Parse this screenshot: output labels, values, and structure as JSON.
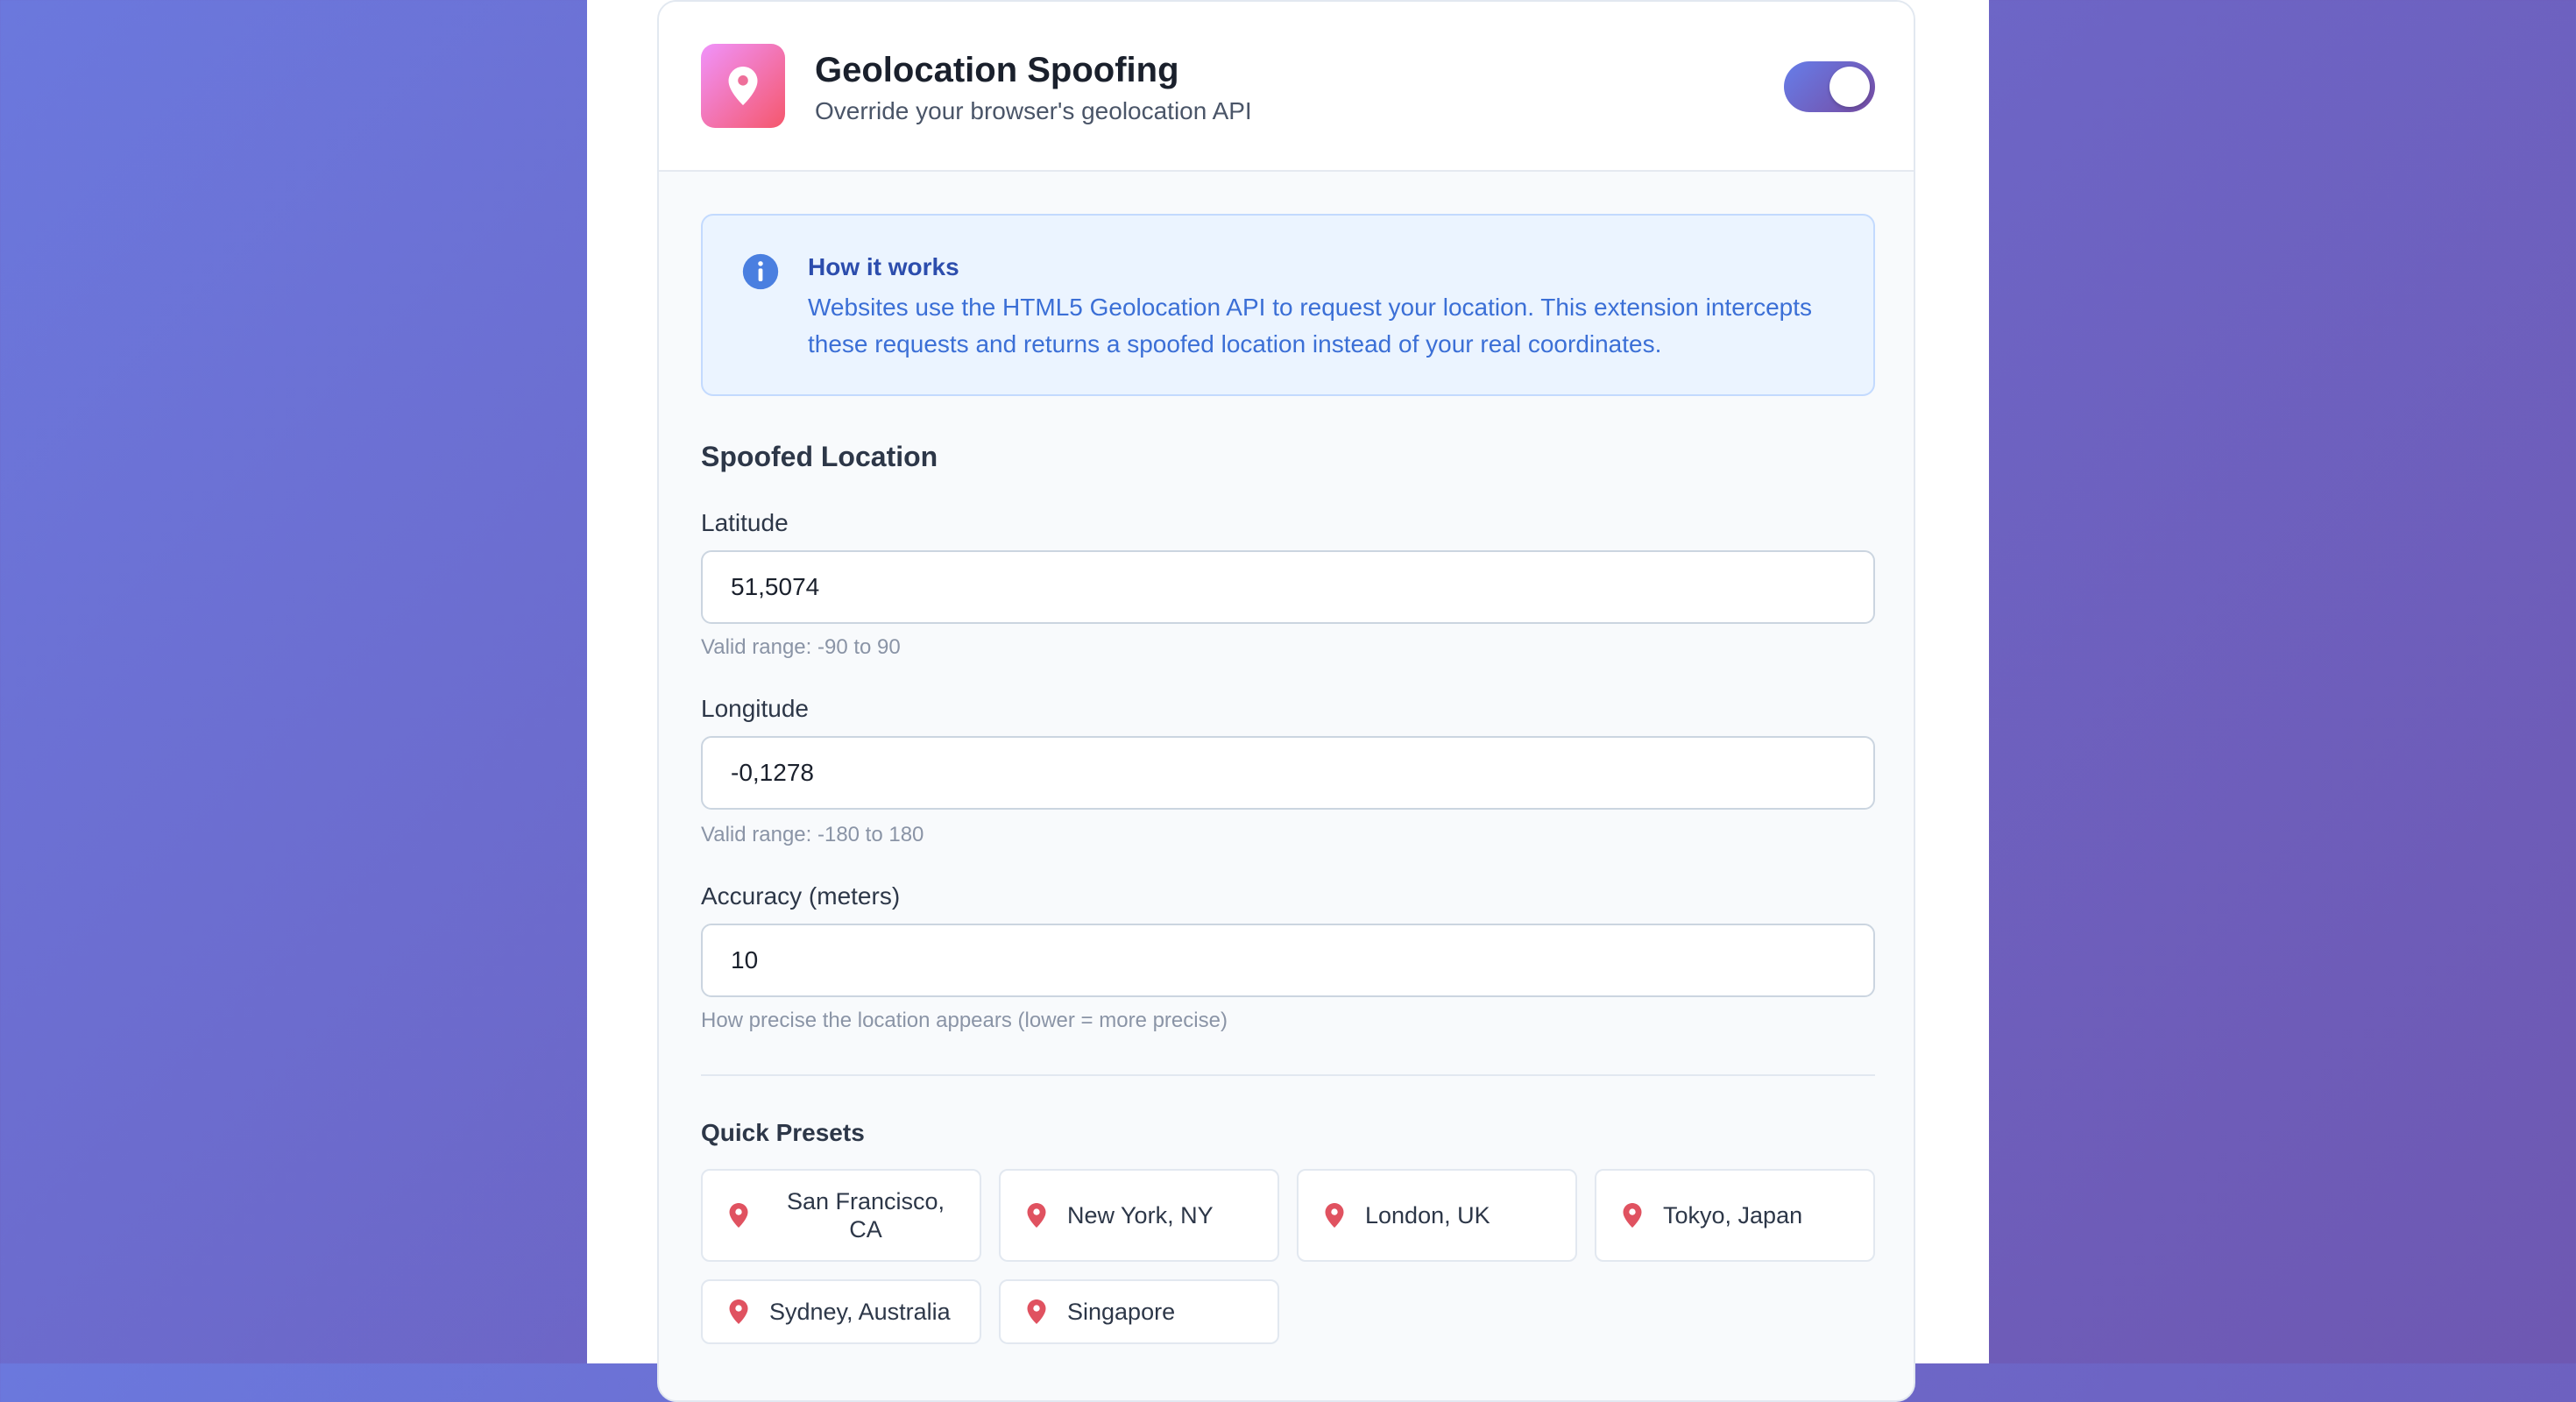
{
  "header": {
    "title": "Geolocation Spoofing",
    "subtitle": "Override your browser's geolocation API",
    "toggle_enabled": true
  },
  "info": {
    "title": "How it works",
    "text": "Websites use the HTML5 Geolocation API to request your location. This extension intercepts these requests and returns a spoofed location instead of your real coordinates."
  },
  "location": {
    "section_title": "Spoofed Location",
    "latitude": {
      "label": "Latitude",
      "value": "51,5074",
      "hint": "Valid range: -90 to 90"
    },
    "longitude": {
      "label": "Longitude",
      "value": "-0,1278",
      "hint": "Valid range: -180 to 180"
    },
    "accuracy": {
      "label": "Accuracy (meters)",
      "value": "10",
      "hint": "How precise the location appears (lower = more precise)"
    }
  },
  "presets": {
    "title": "Quick Presets",
    "items": [
      {
        "label": "San Francisco, CA"
      },
      {
        "label": "New York, NY"
      },
      {
        "label": "London, UK"
      },
      {
        "label": "Tokyo, Japan"
      },
      {
        "label": "Sydney, Australia"
      },
      {
        "label": "Singapore"
      }
    ]
  },
  "colors": {
    "accent_start": "#667eea",
    "accent_end": "#764ba2",
    "icon_gradient_start": "#f093fb",
    "icon_gradient_end": "#f5576c",
    "pin": "#e05260",
    "info_blue": "#3b6fd6"
  },
  "icons": {
    "app": "map-pin-icon",
    "info": "info-icon",
    "preset": "map-pin-icon"
  }
}
